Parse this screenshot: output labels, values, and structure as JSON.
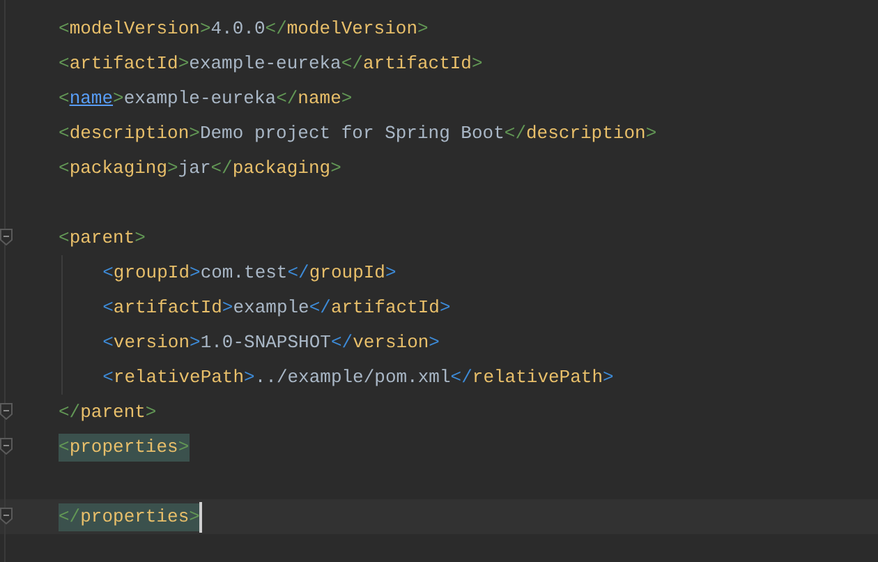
{
  "editor": {
    "lines": [
      {
        "tokens": [
          {
            "kind": "bracket",
            "text": "<"
          },
          {
            "kind": "tag",
            "text": "modelVersion"
          },
          {
            "kind": "bracket",
            "text": ">"
          },
          {
            "kind": "text",
            "text": "4.0.0"
          },
          {
            "kind": "bracket",
            "text": "</"
          },
          {
            "kind": "tag",
            "text": "modelVersion"
          },
          {
            "kind": "bracket",
            "text": ">"
          }
        ]
      },
      {
        "tokens": [
          {
            "kind": "bracket",
            "text": "<"
          },
          {
            "kind": "tag",
            "text": "artifactId"
          },
          {
            "kind": "bracket",
            "text": ">"
          },
          {
            "kind": "text",
            "text": "example-eureka"
          },
          {
            "kind": "bracket",
            "text": "</"
          },
          {
            "kind": "tag",
            "text": "artifactId"
          },
          {
            "kind": "bracket",
            "text": ">"
          }
        ]
      },
      {
        "tokens": [
          {
            "kind": "bracket",
            "text": "<"
          },
          {
            "kind": "link",
            "text": "name"
          },
          {
            "kind": "bracket",
            "text": ">"
          },
          {
            "kind": "text",
            "text": "example-eureka"
          },
          {
            "kind": "bracket",
            "text": "</"
          },
          {
            "kind": "tag",
            "text": "name"
          },
          {
            "kind": "bracket",
            "text": ">"
          }
        ]
      },
      {
        "tokens": [
          {
            "kind": "bracket",
            "text": "<"
          },
          {
            "kind": "tag",
            "text": "description"
          },
          {
            "kind": "bracket",
            "text": ">"
          },
          {
            "kind": "text",
            "text": "Demo project for Spring Boot"
          },
          {
            "kind": "bracket",
            "text": "</"
          },
          {
            "kind": "tag",
            "text": "description"
          },
          {
            "kind": "bracket",
            "text": ">"
          }
        ]
      },
      {
        "tokens": [
          {
            "kind": "bracket",
            "text": "<"
          },
          {
            "kind": "tag",
            "text": "packaging"
          },
          {
            "kind": "bracket",
            "text": ">"
          },
          {
            "kind": "text",
            "text": "jar"
          },
          {
            "kind": "bracket",
            "text": "</"
          },
          {
            "kind": "tag",
            "text": "packaging"
          },
          {
            "kind": "bracket",
            "text": ">"
          }
        ]
      },
      {
        "kind": "blank"
      },
      {
        "fold": true,
        "tokens": [
          {
            "kind": "bracket",
            "text": "<"
          },
          {
            "kind": "tag",
            "text": "parent"
          },
          {
            "kind": "bracket",
            "text": ">"
          }
        ],
        "children": [
          {
            "tokens": [
              {
                "kind": "bracket",
                "text": "<"
              },
              {
                "kind": "tag",
                "text": "groupId"
              },
              {
                "kind": "bracket",
                "text": ">"
              },
              {
                "kind": "text",
                "text": "com.test"
              },
              {
                "kind": "bracket",
                "text": "</"
              },
              {
                "kind": "tag",
                "text": "groupId"
              },
              {
                "kind": "bracket",
                "text": ">"
              }
            ]
          },
          {
            "tokens": [
              {
                "kind": "bracket",
                "text": "<"
              },
              {
                "kind": "tag",
                "text": "artifactId"
              },
              {
                "kind": "bracket",
                "text": ">"
              },
              {
                "kind": "text",
                "text": "example"
              },
              {
                "kind": "bracket",
                "text": "</"
              },
              {
                "kind": "tag",
                "text": "artifactId"
              },
              {
                "kind": "bracket",
                "text": ">"
              }
            ]
          },
          {
            "tokens": [
              {
                "kind": "bracket",
                "text": "<"
              },
              {
                "kind": "tag",
                "text": "version"
              },
              {
                "kind": "bracket",
                "text": ">"
              },
              {
                "kind": "text",
                "text": "1.0-SNAPSHOT"
              },
              {
                "kind": "bracket",
                "text": "</"
              },
              {
                "kind": "tag",
                "text": "version"
              },
              {
                "kind": "bracket",
                "text": ">"
              }
            ]
          },
          {
            "tokens": [
              {
                "kind": "bracket",
                "text": "<"
              },
              {
                "kind": "tag",
                "text": "relativePath"
              },
              {
                "kind": "bracket",
                "text": ">"
              },
              {
                "kind": "text",
                "text": "../example/pom.xml"
              },
              {
                "kind": "bracket",
                "text": "</"
              },
              {
                "kind": "tag",
                "text": "relativePath"
              },
              {
                "kind": "bracket",
                "text": ">"
              }
            ]
          }
        ]
      },
      {
        "fold": true,
        "tokens": [
          {
            "kind": "bracket",
            "text": "</"
          },
          {
            "kind": "tag",
            "text": "parent"
          },
          {
            "kind": "bracket",
            "text": ">"
          }
        ]
      },
      {
        "fold": true,
        "matched": true,
        "tokens": [
          {
            "kind": "bracket",
            "text": "<"
          },
          {
            "kind": "tag",
            "text": "properties"
          },
          {
            "kind": "bracket",
            "text": ">"
          }
        ]
      },
      {
        "kind": "blank"
      },
      {
        "fold": true,
        "matched": true,
        "current": true,
        "tokens": [
          {
            "kind": "bracket",
            "text": "</"
          },
          {
            "kind": "tag",
            "text": "properties"
          },
          {
            "kind": "bracket",
            "text": ">"
          }
        ]
      }
    ]
  }
}
